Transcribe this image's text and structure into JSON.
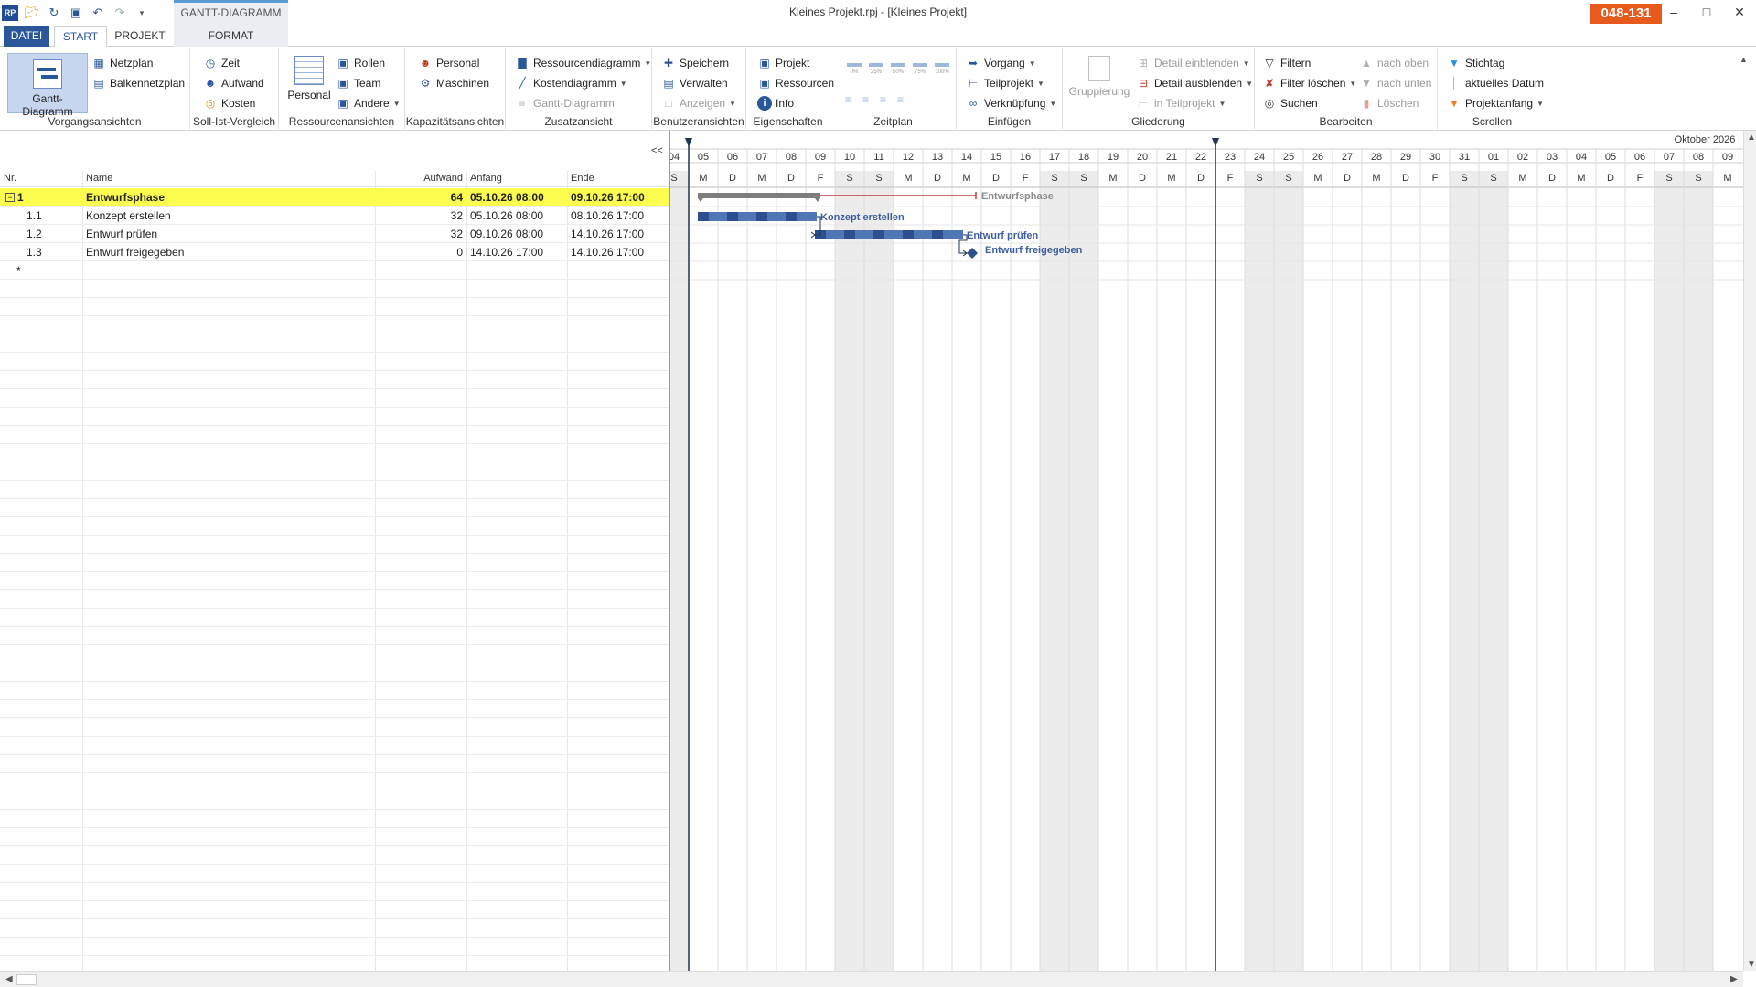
{
  "window": {
    "title": "Kleines Projekt.rpj - [Kleines Projekt]",
    "badge": "048-131",
    "context_tab": "GANTT-DIAGRAMM",
    "qat_logo": "RP"
  },
  "tabs": {
    "datei": "DATEI",
    "start": "START",
    "projekt": "PROJEKT",
    "format": "FORMAT"
  },
  "ribbon": {
    "vorgangsansichten": {
      "label": "Vorgangsansichten",
      "gantt": "Gantt-Diagramm",
      "netzplan": "Netzplan",
      "balkennetzplan": "Balkennetzplan"
    },
    "soll_ist": {
      "label": "Soll-Ist-Vergleich",
      "zeit": "Zeit",
      "aufwand": "Aufwand",
      "kosten": "Kosten"
    },
    "ressourcenansichten": {
      "label": "Ressourcenansichten",
      "personal": "Personal",
      "rollen": "Rollen",
      "team": "Team",
      "andere": "Andere"
    },
    "kapazitaet": {
      "label": "Kapazitätsansichten",
      "personal": "Personal",
      "maschinen": "Maschinen"
    },
    "zusatz": {
      "label": "Zusatzansicht",
      "ressourcendiagramm": "Ressourcendiagramm",
      "kostendiagramm": "Kostendiagramm",
      "gantt": "Gantt-Diagramm"
    },
    "benutzer": {
      "label": "Benutzeransichten",
      "speichern": "Speichern",
      "verwalten": "Verwalten",
      "anzeigen": "Anzeigen"
    },
    "eigenschaften": {
      "label": "Eigenschaften",
      "projekt": "Projekt",
      "ressourcen": "Ressourcen",
      "info": "Info"
    },
    "zeitplan": {
      "label": "Zeitplan",
      "zoom": [
        "0%",
        "25%",
        "50%",
        "75%",
        "100%"
      ]
    },
    "einfuegen": {
      "label": "Einfügen",
      "vorgang": "Vorgang",
      "teilprojekt": "Teilprojekt",
      "verknuepfung": "Verknüpfung"
    },
    "gliederung": {
      "label": "Gliederung",
      "gruppierung": "Gruppierung",
      "detail_ein": "Detail einblenden",
      "detail_aus": "Detail ausblenden",
      "in_teilprojekt": "in Teilprojekt"
    },
    "bearbeiten": {
      "label": "Bearbeiten",
      "filtern": "Filtern",
      "filter_loeschen": "Filter löschen",
      "suchen": "Suchen",
      "nach_oben": "nach oben",
      "nach_unten": "nach unten",
      "loeschen": "Löschen"
    },
    "scrollen": {
      "label": "Scrollen",
      "stichtag": "Stichtag",
      "aktuelles_datum": "aktuelles Datum",
      "projektanfang": "Projektanfang"
    }
  },
  "table": {
    "collapse": "<<",
    "columns": {
      "nr": "Nr.",
      "name": "Name",
      "aufwand": "Aufwand",
      "anfang": "Anfang",
      "ende": "Ende"
    },
    "rows": [
      {
        "nr": "1",
        "name": "Entwurfsphase",
        "aufwand": "64",
        "anfang": "05.10.26 08:00",
        "ende": "09.10.26 17:00"
      },
      {
        "nr": "1.1",
        "name": "Konzept erstellen",
        "aufwand": "32",
        "anfang": "05.10.26 08:00",
        "ende": "08.10.26 17:00"
      },
      {
        "nr": "1.2",
        "name": "Entwurf prüfen",
        "aufwand": "32",
        "anfang": "09.10.26 08:00",
        "ende": "14.10.26 17:00"
      },
      {
        "nr": "1.3",
        "name": "Entwurf freigegeben",
        "aufwand": "0",
        "anfang": "14.10.26 17:00",
        "ende": "14.10.26 17:00"
      }
    ],
    "new_row": "*"
  },
  "gantt": {
    "month_label": "Oktober 2026",
    "days": [
      {
        "d": "04",
        "w": "S",
        "we": true
      },
      {
        "d": "05",
        "w": "M",
        "we": false
      },
      {
        "d": "06",
        "w": "D",
        "we": false
      },
      {
        "d": "07",
        "w": "M",
        "we": false
      },
      {
        "d": "08",
        "w": "D",
        "we": false
      },
      {
        "d": "09",
        "w": "F",
        "we": false
      },
      {
        "d": "10",
        "w": "S",
        "we": true
      },
      {
        "d": "11",
        "w": "S",
        "we": true
      },
      {
        "d": "12",
        "w": "M",
        "we": false
      },
      {
        "d": "13",
        "w": "D",
        "we": false
      },
      {
        "d": "14",
        "w": "M",
        "we": false
      },
      {
        "d": "15",
        "w": "D",
        "we": false
      },
      {
        "d": "16",
        "w": "F",
        "we": false
      },
      {
        "d": "17",
        "w": "S",
        "we": true
      },
      {
        "d": "18",
        "w": "S",
        "we": true
      },
      {
        "d": "19",
        "w": "M",
        "we": false
      },
      {
        "d": "20",
        "w": "D",
        "we": false
      },
      {
        "d": "21",
        "w": "M",
        "we": false
      },
      {
        "d": "22",
        "w": "D",
        "we": false
      },
      {
        "d": "23",
        "w": "F",
        "we": false
      },
      {
        "d": "24",
        "w": "S",
        "we": true
      },
      {
        "d": "25",
        "w": "S",
        "we": true
      },
      {
        "d": "26",
        "w": "M",
        "we": false
      },
      {
        "d": "27",
        "w": "D",
        "we": false
      },
      {
        "d": "28",
        "w": "M",
        "we": false
      },
      {
        "d": "29",
        "w": "D",
        "we": false
      },
      {
        "d": "30",
        "w": "F",
        "we": false
      },
      {
        "d": "31",
        "w": "S",
        "we": true
      },
      {
        "d": "01",
        "w": "S",
        "we": true
      },
      {
        "d": "02",
        "w": "M",
        "we": false
      },
      {
        "d": "03",
        "w": "D",
        "we": false
      },
      {
        "d": "04",
        "w": "M",
        "we": false
      },
      {
        "d": "05",
        "w": "D",
        "we": false
      },
      {
        "d": "06",
        "w": "F",
        "we": false
      },
      {
        "d": "07",
        "w": "S",
        "we": true
      },
      {
        "d": "08",
        "w": "S",
        "we": true
      },
      {
        "d": "09",
        "w": "M",
        "we": false
      }
    ],
    "markers_day_index": [
      1,
      19
    ],
    "tasks": [
      {
        "label": "Entwurfsphase",
        "type": "summary",
        "start": 1,
        "end": 5,
        "plan_end": 10
      },
      {
        "label": "Konzept erstellen",
        "type": "task",
        "start": 1,
        "end": 5
      },
      {
        "label": "Entwurf prüfen",
        "type": "task",
        "start": 5,
        "end": 10
      },
      {
        "label": "Entwurf freigegeben",
        "type": "milestone",
        "start": 10,
        "end": 10
      }
    ],
    "colors": {
      "task": "#4f77b5",
      "task_dark": "#2d4f8f",
      "summary": "#7d7d7d",
      "summary_label": "#8a8a8a",
      "task_label": "#3d5f9e",
      "weekend": "#ececec",
      "plan_line": "#c23b3b"
    }
  }
}
